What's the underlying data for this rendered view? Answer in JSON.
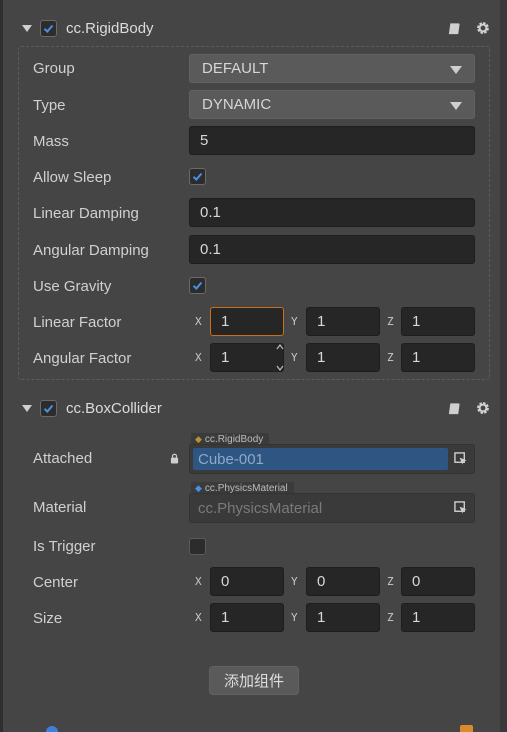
{
  "rigidbody": {
    "title": "cc.RigidBody",
    "enabled": true,
    "group": {
      "label": "Group",
      "value": "DEFAULT"
    },
    "type": {
      "label": "Type",
      "value": "DYNAMIC"
    },
    "mass": {
      "label": "Mass",
      "value": "5"
    },
    "allow_sleep": {
      "label": "Allow Sleep",
      "checked": true
    },
    "linear_damping": {
      "label": "Linear Damping",
      "value": "0.1"
    },
    "angular_damping": {
      "label": "Angular Damping",
      "value": "0.1"
    },
    "use_gravity": {
      "label": "Use Gravity",
      "checked": true
    },
    "linear_factor": {
      "label": "Linear Factor",
      "x": "1",
      "y": "1",
      "z": "1"
    },
    "angular_factor": {
      "label": "Angular Factor",
      "x": "1",
      "y": "1",
      "z": "1"
    }
  },
  "boxcollider": {
    "title": "cc.BoxCollider",
    "enabled": true,
    "attached": {
      "label": "Attached",
      "tag": "cc.RigidBody",
      "value": "Cube-001"
    },
    "material": {
      "label": "Material",
      "tag": "cc.PhysicsMaterial",
      "placeholder": "cc.PhysicsMaterial"
    },
    "is_trigger": {
      "label": "Is Trigger",
      "checked": false
    },
    "center": {
      "label": "Center",
      "x": "0",
      "y": "0",
      "z": "0"
    },
    "size": {
      "label": "Size",
      "x": "1",
      "y": "1",
      "z": "1"
    }
  },
  "axes": {
    "x": "X",
    "y": "Y",
    "z": "Z"
  },
  "add_component_label": "添加组件",
  "icons": {
    "help": "book-icon",
    "settings": "gear-icon",
    "lock": "lock-icon",
    "picker": "object-picker-icon"
  },
  "colors": {
    "checkbox_accent": "#4a90e2",
    "focus_border": "#c9701b",
    "attached_fill": "#2f5683"
  }
}
